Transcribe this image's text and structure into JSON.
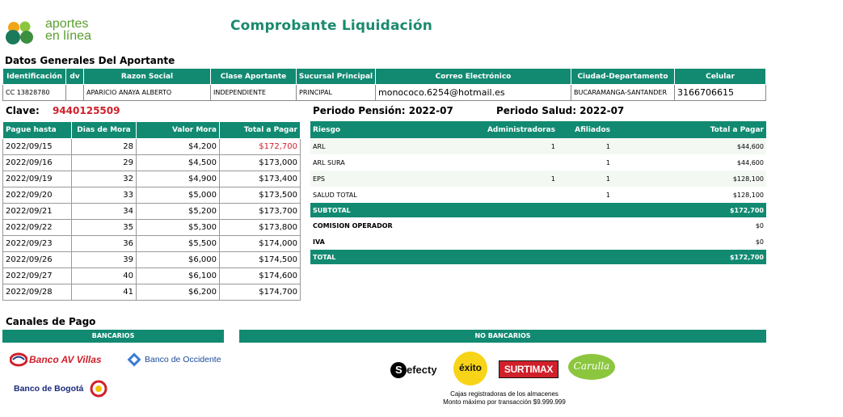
{
  "header": {
    "logo_text_1": "aportes",
    "logo_text_2": "en línea",
    "title": "Comprobante Liquidación"
  },
  "general": {
    "section_title": "Datos Generales Del Aportante",
    "columns": [
      "Identificación",
      "dv",
      "Razon Social",
      "Clase Aportante",
      "Sucursal Principal",
      "Correo Electrónico",
      "Ciudad-Departamento",
      "Celular"
    ],
    "values": [
      "CC 13828780",
      "",
      "APARICIO ANAYA ALBERTO",
      "INDEPENDIENTE",
      "PRINCIPAL",
      "monococo.6254@hotmail.es",
      "BUCARAMANGA-SANTANDER",
      "3166706615"
    ]
  },
  "clave": {
    "label": "Clave:",
    "value": "9440125509"
  },
  "periodo_pension": "Periodo Pensión: 2022-07",
  "periodo_salud": "Periodo Salud: 2022-07",
  "mora": {
    "columns": [
      "Pague hasta",
      "Dias de Mora",
      "Valor Mora",
      "Total a Pagar"
    ],
    "rows": [
      [
        "2022/09/15",
        "28",
        "$4,200",
        "$172,700"
      ],
      [
        "2022/09/16",
        "29",
        "$4,500",
        "$173,000"
      ],
      [
        "2022/09/19",
        "32",
        "$4,900",
        "$173,400"
      ],
      [
        "2022/09/20",
        "33",
        "$5,000",
        "$173,500"
      ],
      [
        "2022/09/21",
        "34",
        "$5,200",
        "$173,700"
      ],
      [
        "2022/09/22",
        "35",
        "$5,300",
        "$173,800"
      ],
      [
        "2022/09/23",
        "36",
        "$5,500",
        "$174,000"
      ],
      [
        "2022/09/26",
        "39",
        "$6,000",
        "$174,500"
      ],
      [
        "2022/09/27",
        "40",
        "$6,100",
        "$174,600"
      ],
      [
        "2022/09/28",
        "41",
        "$6,200",
        "$174,700"
      ]
    ]
  },
  "riesgo": {
    "columns": [
      "Riesgo",
      "Administradoras",
      "Afiliados",
      "Total a Pagar"
    ],
    "rows": [
      [
        "ARL",
        "1",
        "1",
        "$44,600"
      ],
      [
        "ARL SURA",
        "",
        "1",
        "$44,600"
      ],
      [
        "EPS",
        "1",
        "1",
        "$128,100"
      ],
      [
        "SALUD TOTAL",
        "",
        "1",
        "$128,100"
      ]
    ],
    "subtotal": {
      "label": "SUBTOTAL",
      "value": "$172,700"
    },
    "comision": {
      "label": "COMISION OPERADOR",
      "value": "$0"
    },
    "iva": {
      "label": "IVA",
      "value": "$0"
    },
    "total": {
      "label": "TOTAL",
      "value": "$172,700"
    }
  },
  "canales": {
    "title": "Canales de Pago",
    "bancarios": "BANCARIOS",
    "no_bancarios": "NO BANCARIOS",
    "banks": [
      "Banco AV Villas",
      "Banco de Occidente",
      "Banco de Bogotá"
    ],
    "stores": [
      "efecty",
      "éxito",
      "SURTIMAX",
      "Carulla"
    ],
    "note_line1": "Cajas registradoras de los almacenes",
    "note_line2": "Monto máximo por transacción $9.999.999"
  },
  "colors": {
    "accent": "#128a72",
    "red": "#d0202a",
    "title": "#1a8a6e"
  }
}
